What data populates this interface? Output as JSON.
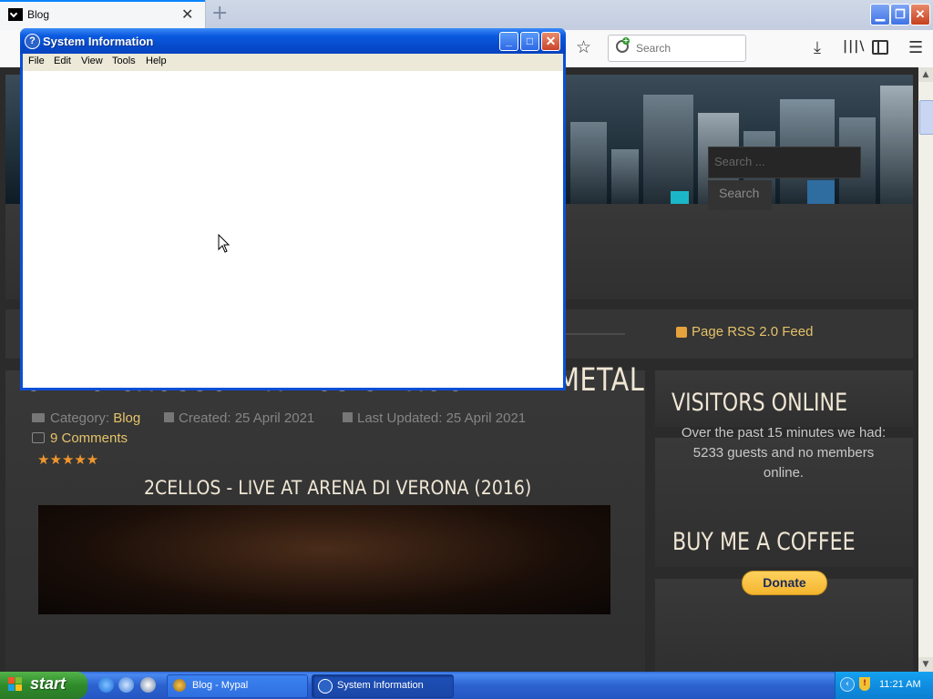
{
  "browser": {
    "tab_title": "Blog",
    "tab_close": "✕",
    "new_tab": "+",
    "search_placeholder": "Search",
    "bookmark_star": "☆",
    "download_icon": "⤓",
    "library_icon": "|||\\",
    "menu_icon": "☰",
    "min_glyph": "▁",
    "max_glyph": "❐",
    "close_glyph": "✕"
  },
  "page": {
    "search_placeholder": "Search ...",
    "search_button": "Search",
    "article": {
      "title": "CELLO CROSSOVER MUSIC - ROCK AND METAL",
      "category_label": "Category: ",
      "category": "Blog",
      "created": "Created: 25 April 2021",
      "updated": "Last Updated: 25 April 2021",
      "comments": "9 Comments",
      "rating_stars": "★★★★★",
      "subtitle": "2CELLOS - LIVE AT ARENA DI VERONA (2016)"
    },
    "sidebar": {
      "rss": "Page RSS 2.0 Feed",
      "visitors_title": "VISITORS ONLINE",
      "visitors_text": "Over the past 15 minutes we had: 5233 guests and no members online.",
      "coffee_title": "BUY ME A COFFEE",
      "donate": "Donate"
    }
  },
  "xp_window": {
    "title": "System Information",
    "icon_glyph": "?",
    "min": "_",
    "max": "□",
    "close": "✕",
    "menu": [
      "File",
      "Edit",
      "View",
      "Tools",
      "Help"
    ]
  },
  "taskbar": {
    "start": "start",
    "tasks": [
      "Blog - Mypal",
      "System Information"
    ],
    "clock": "11:21 AM",
    "tray_arrow": "‹",
    "tray_shield": "!"
  },
  "colors": {
    "accent_link": "#e6c36a",
    "xp_blue": "#0a4fd6",
    "star": "#f0962c"
  }
}
